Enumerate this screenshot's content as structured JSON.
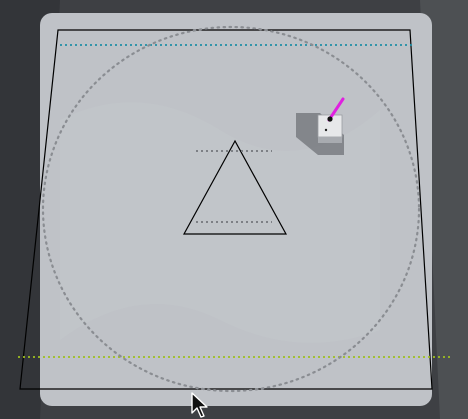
{
  "scene": {
    "background_color": "#3e4044",
    "board_color": "#bfc2c7",
    "outline_color": "#000000",
    "top_line_color": "#1f8fa6",
    "bottom_line_color": "#9fbf1f",
    "circle_dot_color": "#8a8d92",
    "pointer_color": "#e020e0"
  },
  "icons": {
    "cursor": "arrow-cursor-icon",
    "agent": "agent-block-icon"
  }
}
